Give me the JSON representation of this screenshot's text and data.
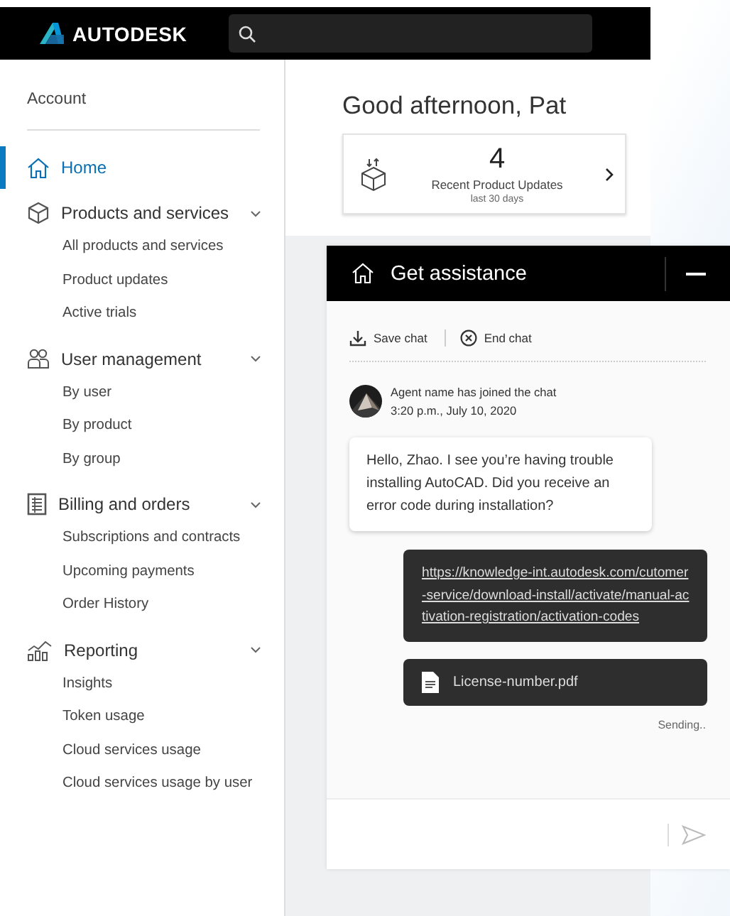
{
  "header": {
    "brand": "AUTODESK"
  },
  "sidebar": {
    "title": "Account",
    "items": [
      {
        "label": "Home",
        "selected": true
      },
      {
        "label": "Products and services",
        "selected": false,
        "expanded": true,
        "children": [
          {
            "label": "All products and services",
            "selected": false
          },
          {
            "label": "Product updates",
            "selected": false
          },
          {
            "label": "Active trials",
            "selected": false
          }
        ]
      },
      {
        "label": "User management",
        "selected": false,
        "expanded": true,
        "children": [
          {
            "label": "By user",
            "selected": false
          },
          {
            "label": "By product",
            "selected": false
          },
          {
            "label": "By group",
            "selected": false
          }
        ]
      },
      {
        "label": "Billing and orders",
        "selected": false,
        "expanded": true,
        "children": [
          {
            "label": "Subscriptions and contracts",
            "selected": false
          },
          {
            "label": "Upcoming payments",
            "selected": false
          },
          {
            "label": "Order History",
            "selected": false
          }
        ]
      },
      {
        "label": "Reporting",
        "selected": false,
        "expanded": true,
        "children": [
          {
            "label": "Insights",
            "selected": false
          },
          {
            "label": "Token usage",
            "selected": false
          },
          {
            "label": "Cloud services usage",
            "selected": false
          },
          {
            "label": "Cloud services usage by user",
            "selected": false
          }
        ]
      }
    ]
  },
  "main": {
    "greeting": "Good afternoon, Pat",
    "card": {
      "count": "4",
      "label": "Recent Product Updates",
      "sublabel": "last 30 days"
    }
  },
  "chat": {
    "title": "Get assistance",
    "actions": [
      {
        "label": "Save chat"
      },
      {
        "label": "End chat"
      }
    ],
    "messages": [
      {
        "kind": "system",
        "text": "Agent name has joined the chat",
        "time": "3:20 p.m., July 10, 2020"
      },
      {
        "kind": "agent",
        "text": "Hello, Zhao. I see you’re having trouble installing AutoCAD. Did you receive an error code during installation?"
      },
      {
        "kind": "link",
        "text": "https://knowledge-int.autodesk.com/cutomer-service/download-install/activate/manual-activation-registration/activation-codes"
      },
      {
        "kind": "file",
        "text": "License-number.pdf"
      }
    ],
    "status": "Sending.."
  }
}
